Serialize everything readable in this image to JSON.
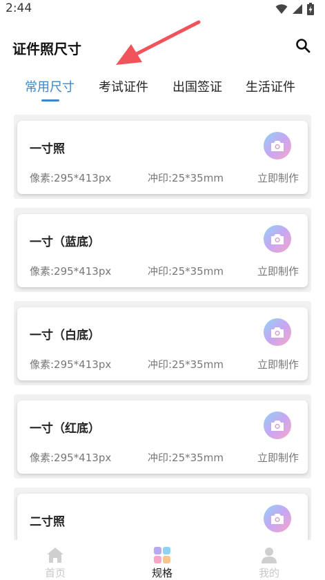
{
  "status_bar": {
    "time": "2:44"
  },
  "header": {
    "title": "证件照尺寸"
  },
  "tabs": [
    {
      "label": "常用尺寸",
      "active": true
    },
    {
      "label": "考试证件",
      "active": false
    },
    {
      "label": "出国签证",
      "active": false
    },
    {
      "label": "生活证件",
      "active": false
    }
  ],
  "photos": [
    {
      "name": "一寸照",
      "pixels": "像素:295*413px",
      "print": "冲印:25*35mm",
      "action": "立即制作"
    },
    {
      "name": "一寸（蓝底）",
      "pixels": "像素:295*413px",
      "print": "冲印:25*35mm",
      "action": "立即制作"
    },
    {
      "name": "一寸（白底）",
      "pixels": "像素:295*413px",
      "print": "冲印:25*35mm",
      "action": "立即制作"
    },
    {
      "name": "一寸（红底）",
      "pixels": "像素:295*413px",
      "print": "冲印:25*35mm",
      "action": "立即制作"
    },
    {
      "name": "二寸照",
      "pixels": "",
      "print": "",
      "action": ""
    }
  ],
  "bottom_nav": [
    {
      "label": "首页",
      "icon": "home-icon",
      "active": false
    },
    {
      "label": "规格",
      "icon": "grid-icon",
      "active": true
    },
    {
      "label": "我的",
      "icon": "user-icon",
      "active": false
    }
  ],
  "colors": {
    "accent": "#3a86c8",
    "arrow": "#f0535a",
    "nav_inactive": "#c8c8c8"
  }
}
